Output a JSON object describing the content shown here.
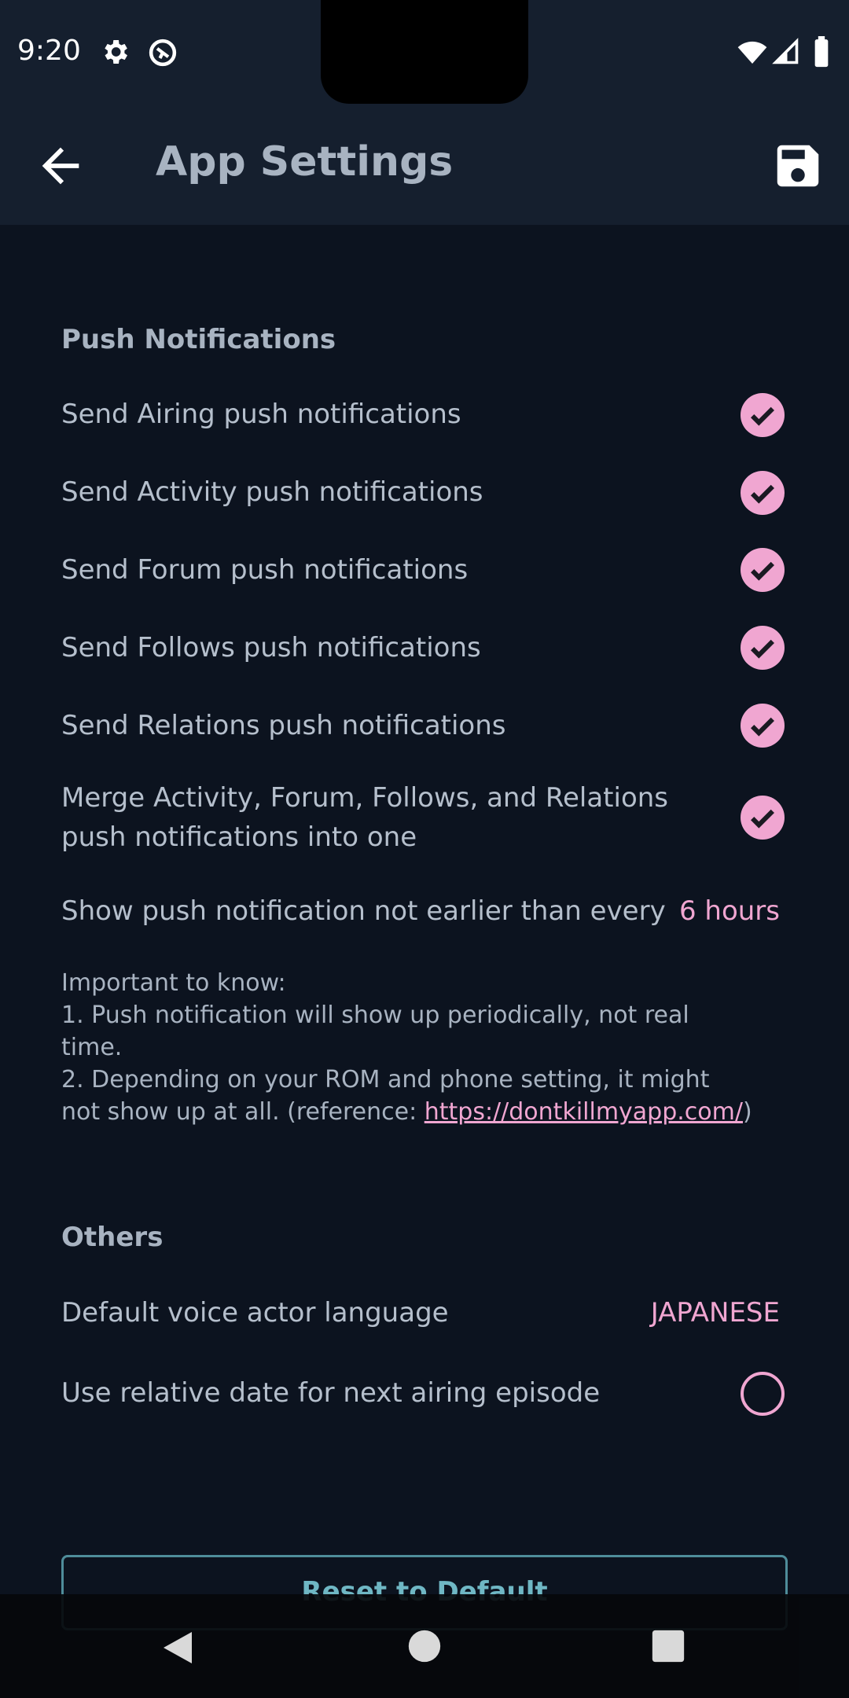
{
  "status_bar": {
    "time": "9:20",
    "icons": [
      "settings-icon",
      "data-saver-icon",
      "wifi-icon",
      "signal-icon",
      "battery-icon"
    ]
  },
  "app_bar": {
    "title": "App Settings",
    "back_icon": "arrow-left-icon",
    "save_icon": "save-icon"
  },
  "push_notifications": {
    "title": "Push Notifications",
    "items": [
      {
        "label": "Send Airing push notifications",
        "checked": true
      },
      {
        "label": "Send Activity push notifications",
        "checked": true
      },
      {
        "label": "Send Forum push notifications",
        "checked": true
      },
      {
        "label": "Send Follows push notifications",
        "checked": true
      },
      {
        "label": "Send Relations push notifications",
        "checked": true
      },
      {
        "label": "Merge Activity, Forum, Follows, and Relations push notifications into one",
        "checked": true
      }
    ],
    "interval": {
      "label": "Show push notification not earlier than every",
      "value": "6 hours"
    },
    "note": {
      "heading": "Important to know:",
      "line1": "1. Push notification will show up periodically, not real time.",
      "line2": "2. Depending on your ROM and phone setting, it might not show up at all. (reference: ",
      "link": "https://dontkillmyapp.com/",
      "line2_end": ")"
    }
  },
  "others": {
    "title": "Others",
    "voice_actor": {
      "label": "Default voice actor language",
      "value": "JAPANESE"
    },
    "relative_date": {
      "label": "Use relative date for next airing episode",
      "checked": false
    }
  },
  "reset_button": {
    "label": "Reset to Default"
  },
  "nav_bar": {
    "icons": [
      "back-triangle-icon",
      "home-circle-icon",
      "recents-square-icon"
    ]
  },
  "colors": {
    "accent": "#f0a6d1",
    "background": "#0c131f",
    "bar": "#151f2e",
    "teal": "#6fb7c4"
  }
}
